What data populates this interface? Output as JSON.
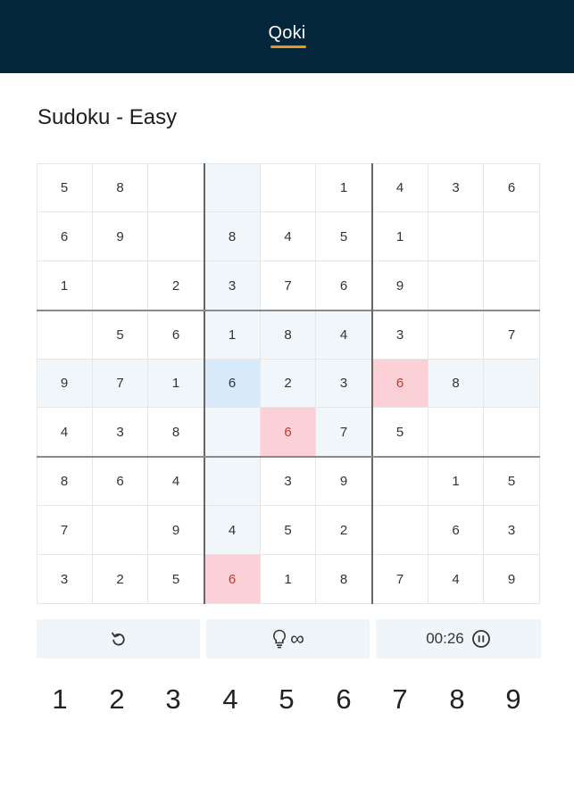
{
  "header": {
    "brand": "Qoki"
  },
  "page": {
    "title": "Sudoku - Easy"
  },
  "board": {
    "grid": [
      [
        "5",
        "8",
        "",
        "",
        "",
        "1",
        "4",
        "3",
        "6"
      ],
      [
        "6",
        "9",
        "",
        "8",
        "4",
        "5",
        "1",
        "",
        ""
      ],
      [
        "1",
        "",
        "2",
        "3",
        "7",
        "6",
        "9",
        "",
        ""
      ],
      [
        "",
        "5",
        "6",
        "1",
        "8",
        "4",
        "3",
        "",
        "7"
      ],
      [
        "9",
        "7",
        "1",
        "6",
        "2",
        "3",
        "6",
        "8",
        ""
      ],
      [
        "4",
        "3",
        "8",
        "",
        "6",
        "7",
        "5",
        "",
        ""
      ],
      [
        "8",
        "6",
        "4",
        "",
        "3",
        "9",
        "",
        "1",
        "5"
      ],
      [
        "7",
        "",
        "9",
        "4",
        "5",
        "2",
        "",
        "6",
        "3"
      ],
      [
        "3",
        "2",
        "5",
        "6",
        "1",
        "8",
        "7",
        "4",
        "9"
      ]
    ],
    "selected_cell": {
      "row": 4,
      "col": 3
    },
    "error_cells": [
      {
        "row": 4,
        "col": 6
      },
      {
        "row": 5,
        "col": 4
      },
      {
        "row": 8,
        "col": 3
      }
    ],
    "colors": {
      "highlight": "#f1f6fa",
      "selected": "#d9ebfb",
      "error": "#fbd0d6"
    }
  },
  "controls": {
    "undo_icon": "undo-icon",
    "hint_icon": "lightbulb-icon",
    "hints_remaining": "∞",
    "timer": "00:26",
    "pause_icon": "pause-icon"
  },
  "numpad": [
    "1",
    "2",
    "3",
    "4",
    "5",
    "6",
    "7",
    "8",
    "9"
  ],
  "theme": {
    "header_bg": "#03263a",
    "accent": "#e8961e"
  }
}
